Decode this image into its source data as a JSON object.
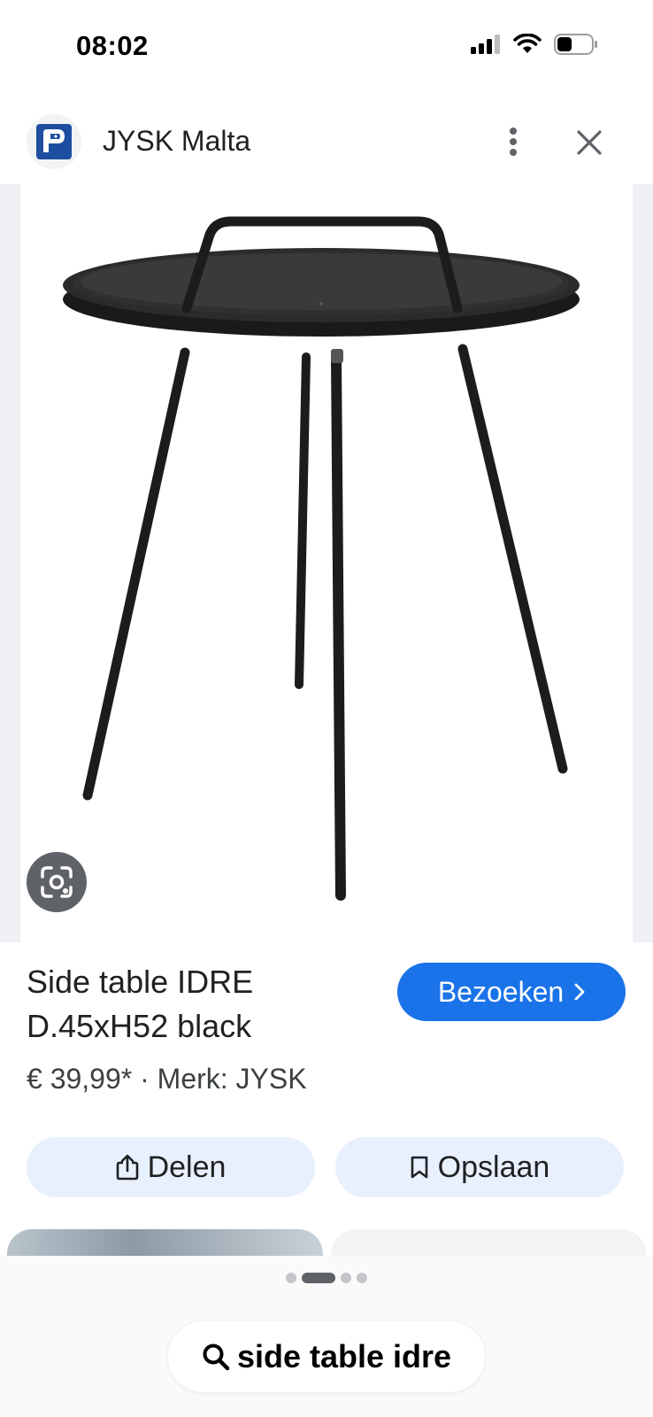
{
  "status_bar": {
    "time": "08:02"
  },
  "header": {
    "site_name": "JYSK Malta",
    "icons": [
      "jysk-logo",
      "more-vert-icon",
      "close-icon"
    ]
  },
  "product": {
    "title_line1": "Side table IDRE",
    "title_line2": "D.45xH52 black",
    "price": "€ 39,99*",
    "separator": "·",
    "brand": "Merk: JYSK",
    "visit_label": "Bezoeken"
  },
  "actions": {
    "share_label": "Delen",
    "save_label": "Opslaan"
  },
  "pagination": {
    "count": 4,
    "active_index": 1
  },
  "search": {
    "query": "side table idre"
  },
  "colors": {
    "accent": "#1a73e8",
    "pill": "#e8f0fe",
    "logo_blue": "#1d4ea0"
  }
}
